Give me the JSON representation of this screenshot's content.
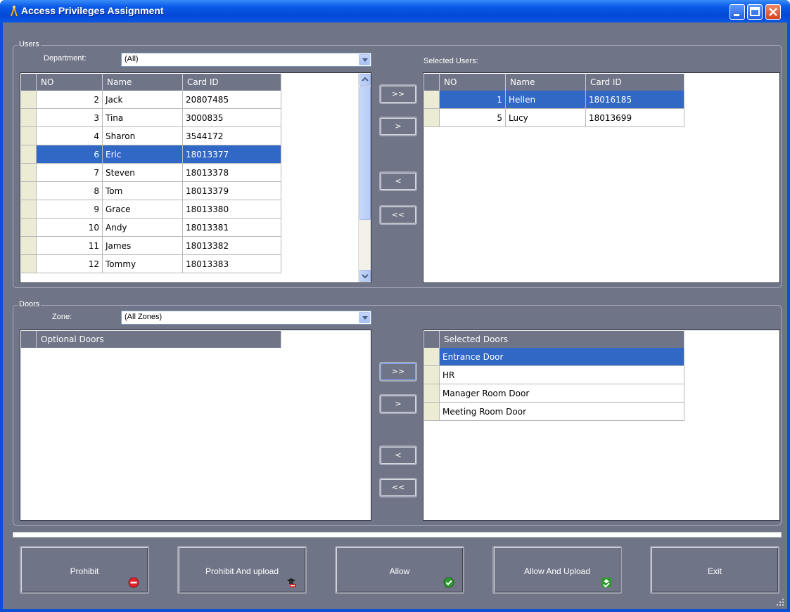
{
  "window": {
    "title": "Access Privileges Assignment"
  },
  "users": {
    "group_label": "Users",
    "department_label": "Department:",
    "department_value": "(All)",
    "available": {
      "columns": [
        "NO",
        "Name",
        "Card ID"
      ],
      "rows": [
        {
          "no": "2",
          "name": "Jack",
          "card": "20807485"
        },
        {
          "no": "3",
          "name": "Tina",
          "card": "3000835"
        },
        {
          "no": "4",
          "name": "Sharon",
          "card": "3544172"
        },
        {
          "no": "6",
          "name": "Eric",
          "card": "18013377"
        },
        {
          "no": "7",
          "name": "Steven",
          "card": "18013378"
        },
        {
          "no": "8",
          "name": "Tom",
          "card": "18013379"
        },
        {
          "no": "9",
          "name": "Grace",
          "card": "18013380"
        },
        {
          "no": "10",
          "name": "Andy",
          "card": "18013381"
        },
        {
          "no": "11",
          "name": "James",
          "card": "18013382"
        },
        {
          "no": "12",
          "name": "Tommy",
          "card": "18013383"
        }
      ],
      "selected_index": 3
    },
    "selected_label": "Selected Users:",
    "selected": {
      "columns": [
        "NO",
        "Name",
        "Card ID"
      ],
      "rows": [
        {
          "no": "1",
          "name": "Hellen",
          "card": "18016185"
        },
        {
          "no": "5",
          "name": "Lucy",
          "card": "18013699"
        }
      ],
      "selected_index": 0
    },
    "move_buttons": [
      ">>",
      ">",
      "<",
      "<<"
    ]
  },
  "doors": {
    "group_label": "Doors",
    "zone_label": "Zone:",
    "zone_value": "(All Zones)",
    "optional_header": "Optional Doors",
    "selected_header": "Selected Doors",
    "selected_rows": [
      "Entrance Door",
      "HR",
      "Manager Room Door",
      "Meeting Room Door"
    ],
    "selected_index": 0,
    "move_buttons": [
      ">>",
      ">",
      "<",
      "<<"
    ]
  },
  "actions": [
    {
      "label": "Prohibit",
      "icon": "no-entry-icon",
      "color": "#e0202a"
    },
    {
      "label": "Prohibit And upload",
      "icon": "prohibit-upload-icon",
      "color": "#d82020"
    },
    {
      "label": "Allow",
      "icon": "check-icon",
      "color": "#2e9a2e"
    },
    {
      "label": "Allow And Upload",
      "icon": "allow-upload-icon",
      "color": "#2e9a2e"
    },
    {
      "label": "Exit",
      "icon": "",
      "color": ""
    }
  ],
  "colors": {
    "panel": "#6f7487",
    "selection": "#3168c6",
    "titlebar": "#0a4fd8"
  }
}
